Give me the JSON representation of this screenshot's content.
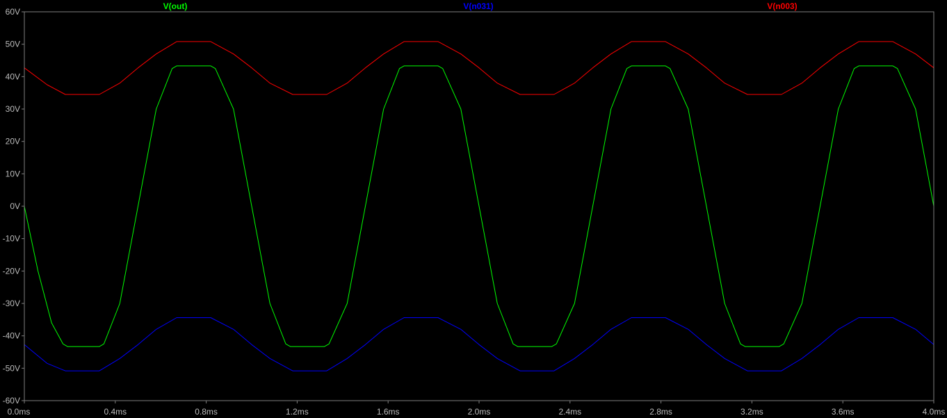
{
  "chart_data": {
    "type": "line",
    "title": "",
    "xlabel": "",
    "ylabel": "",
    "xlim": [
      0,
      4.0
    ],
    "ylim": [
      -60,
      60
    ],
    "grid": false,
    "legend_placement": "top",
    "x_ticks": [
      {
        "value": 0.0,
        "label": "0.0ms"
      },
      {
        "value": 0.4,
        "label": "0.4ms"
      },
      {
        "value": 0.8,
        "label": "0.8ms"
      },
      {
        "value": 1.2,
        "label": "1.2ms"
      },
      {
        "value": 1.6,
        "label": "1.6ms"
      },
      {
        "value": 2.0,
        "label": "2.0ms"
      },
      {
        "value": 2.4,
        "label": "2.4ms"
      },
      {
        "value": 2.8,
        "label": "2.8ms"
      },
      {
        "value": 3.2,
        "label": "3.2ms"
      },
      {
        "value": 3.6,
        "label": "3.6ms"
      },
      {
        "value": 4.0,
        "label": "4.0ms"
      }
    ],
    "y_ticks": [
      {
        "value": 60,
        "label": "60V"
      },
      {
        "value": 50,
        "label": "50V"
      },
      {
        "value": 40,
        "label": "40V"
      },
      {
        "value": 30,
        "label": "30V"
      },
      {
        "value": 20,
        "label": "20V"
      },
      {
        "value": 10,
        "label": "10V"
      },
      {
        "value": 0,
        "label": "0V"
      },
      {
        "value": -10,
        "label": "-10V"
      },
      {
        "value": -20,
        "label": "-20V"
      },
      {
        "value": -30,
        "label": "-30V"
      },
      {
        "value": -40,
        "label": "-40V"
      },
      {
        "value": -50,
        "label": "-50V"
      },
      {
        "value": -60,
        "label": "-60V"
      }
    ],
    "series": [
      {
        "name": "V(out)",
        "color": "#00ff00",
        "x": [
          0.0,
          0.06,
          0.12,
          0.17,
          0.19,
          0.33,
          0.35,
          0.42,
          0.5,
          0.58,
          0.65,
          0.67,
          0.82,
          0.84,
          0.92,
          1.0,
          1.08,
          1.15,
          1.17,
          1.32,
          1.34,
          1.42,
          1.5,
          1.58,
          1.65,
          1.67,
          1.82,
          1.84,
          1.92,
          2.0,
          2.08,
          2.15,
          2.17,
          2.32,
          2.34,
          2.42,
          2.5,
          2.58,
          2.65,
          2.67,
          2.82,
          2.84,
          2.92,
          3.0,
          3.08,
          3.15,
          3.17,
          3.32,
          3.34,
          3.42,
          3.5,
          3.58,
          3.65,
          3.67,
          3.82,
          3.84,
          3.92,
          4.0
        ],
        "y": [
          0.0,
          -20.0,
          -36.0,
          -42.5,
          -43.3,
          -43.3,
          -42.5,
          -30.0,
          0.0,
          30.0,
          42.5,
          43.3,
          43.3,
          42.5,
          30.0,
          0.0,
          -30.0,
          -42.5,
          -43.3,
          -43.3,
          -42.5,
          -30.0,
          0.0,
          30.0,
          42.5,
          43.3,
          43.3,
          42.5,
          30.0,
          0.0,
          -30.0,
          -42.5,
          -43.3,
          -43.3,
          -42.5,
          -30.0,
          0.0,
          30.0,
          42.5,
          43.3,
          43.3,
          42.5,
          30.0,
          0.0,
          -30.0,
          -42.5,
          -43.3,
          -43.3,
          -42.5,
          -30.0,
          0.0,
          30.0,
          42.5,
          43.3,
          43.3,
          42.5,
          30.0,
          0.0
        ]
      },
      {
        "name": "V(n031)",
        "color": "#0000ff",
        "x": [
          0.0,
          0.1,
          0.18,
          0.33,
          0.42,
          0.5,
          0.58,
          0.67,
          0.82,
          0.92,
          1.0,
          1.08,
          1.18,
          1.33,
          1.42,
          1.5,
          1.58,
          1.67,
          1.82,
          1.92,
          2.0,
          2.08,
          2.18,
          2.33,
          2.42,
          2.5,
          2.58,
          2.67,
          2.82,
          2.92,
          3.0,
          3.08,
          3.18,
          3.33,
          3.42,
          3.5,
          3.58,
          3.67,
          3.82,
          3.92,
          4.0
        ],
        "y": [
          -42.7,
          -48.5,
          -50.8,
          -50.8,
          -47.0,
          -42.7,
          -38.0,
          -34.4,
          -34.4,
          -38.0,
          -42.7,
          -47.0,
          -50.8,
          -50.8,
          -47.0,
          -42.7,
          -38.0,
          -34.4,
          -34.4,
          -38.0,
          -42.7,
          -47.0,
          -50.8,
          -50.8,
          -47.0,
          -42.7,
          -38.0,
          -34.4,
          -34.4,
          -38.0,
          -42.7,
          -47.0,
          -50.8,
          -50.8,
          -47.0,
          -42.7,
          -38.0,
          -34.4,
          -34.4,
          -38.0,
          -42.7
        ]
      },
      {
        "name": "V(n003)",
        "color": "#ff0000",
        "x": [
          0.0,
          0.1,
          0.18,
          0.33,
          0.42,
          0.5,
          0.58,
          0.67,
          0.82,
          0.92,
          1.0,
          1.08,
          1.18,
          1.33,
          1.42,
          1.5,
          1.58,
          1.67,
          1.82,
          1.92,
          2.0,
          2.08,
          2.18,
          2.33,
          2.42,
          2.5,
          2.58,
          2.67,
          2.82,
          2.92,
          3.0,
          3.08,
          3.18,
          3.33,
          3.42,
          3.5,
          3.58,
          3.67,
          3.82,
          3.92,
          4.0
        ],
        "y": [
          42.7,
          37.5,
          34.5,
          34.5,
          38.0,
          42.7,
          47.0,
          50.8,
          50.8,
          47.0,
          42.7,
          38.0,
          34.5,
          34.5,
          38.0,
          42.7,
          47.0,
          50.8,
          50.8,
          47.0,
          42.7,
          38.0,
          34.5,
          34.5,
          38.0,
          42.7,
          47.0,
          50.8,
          50.8,
          47.0,
          42.7,
          38.0,
          34.5,
          34.5,
          38.0,
          42.7,
          47.0,
          50.8,
          50.8,
          47.0,
          42.7
        ]
      }
    ]
  },
  "colors": {
    "background": "#000000",
    "axis": "#808080",
    "tick_text": "#bcbcbc"
  }
}
